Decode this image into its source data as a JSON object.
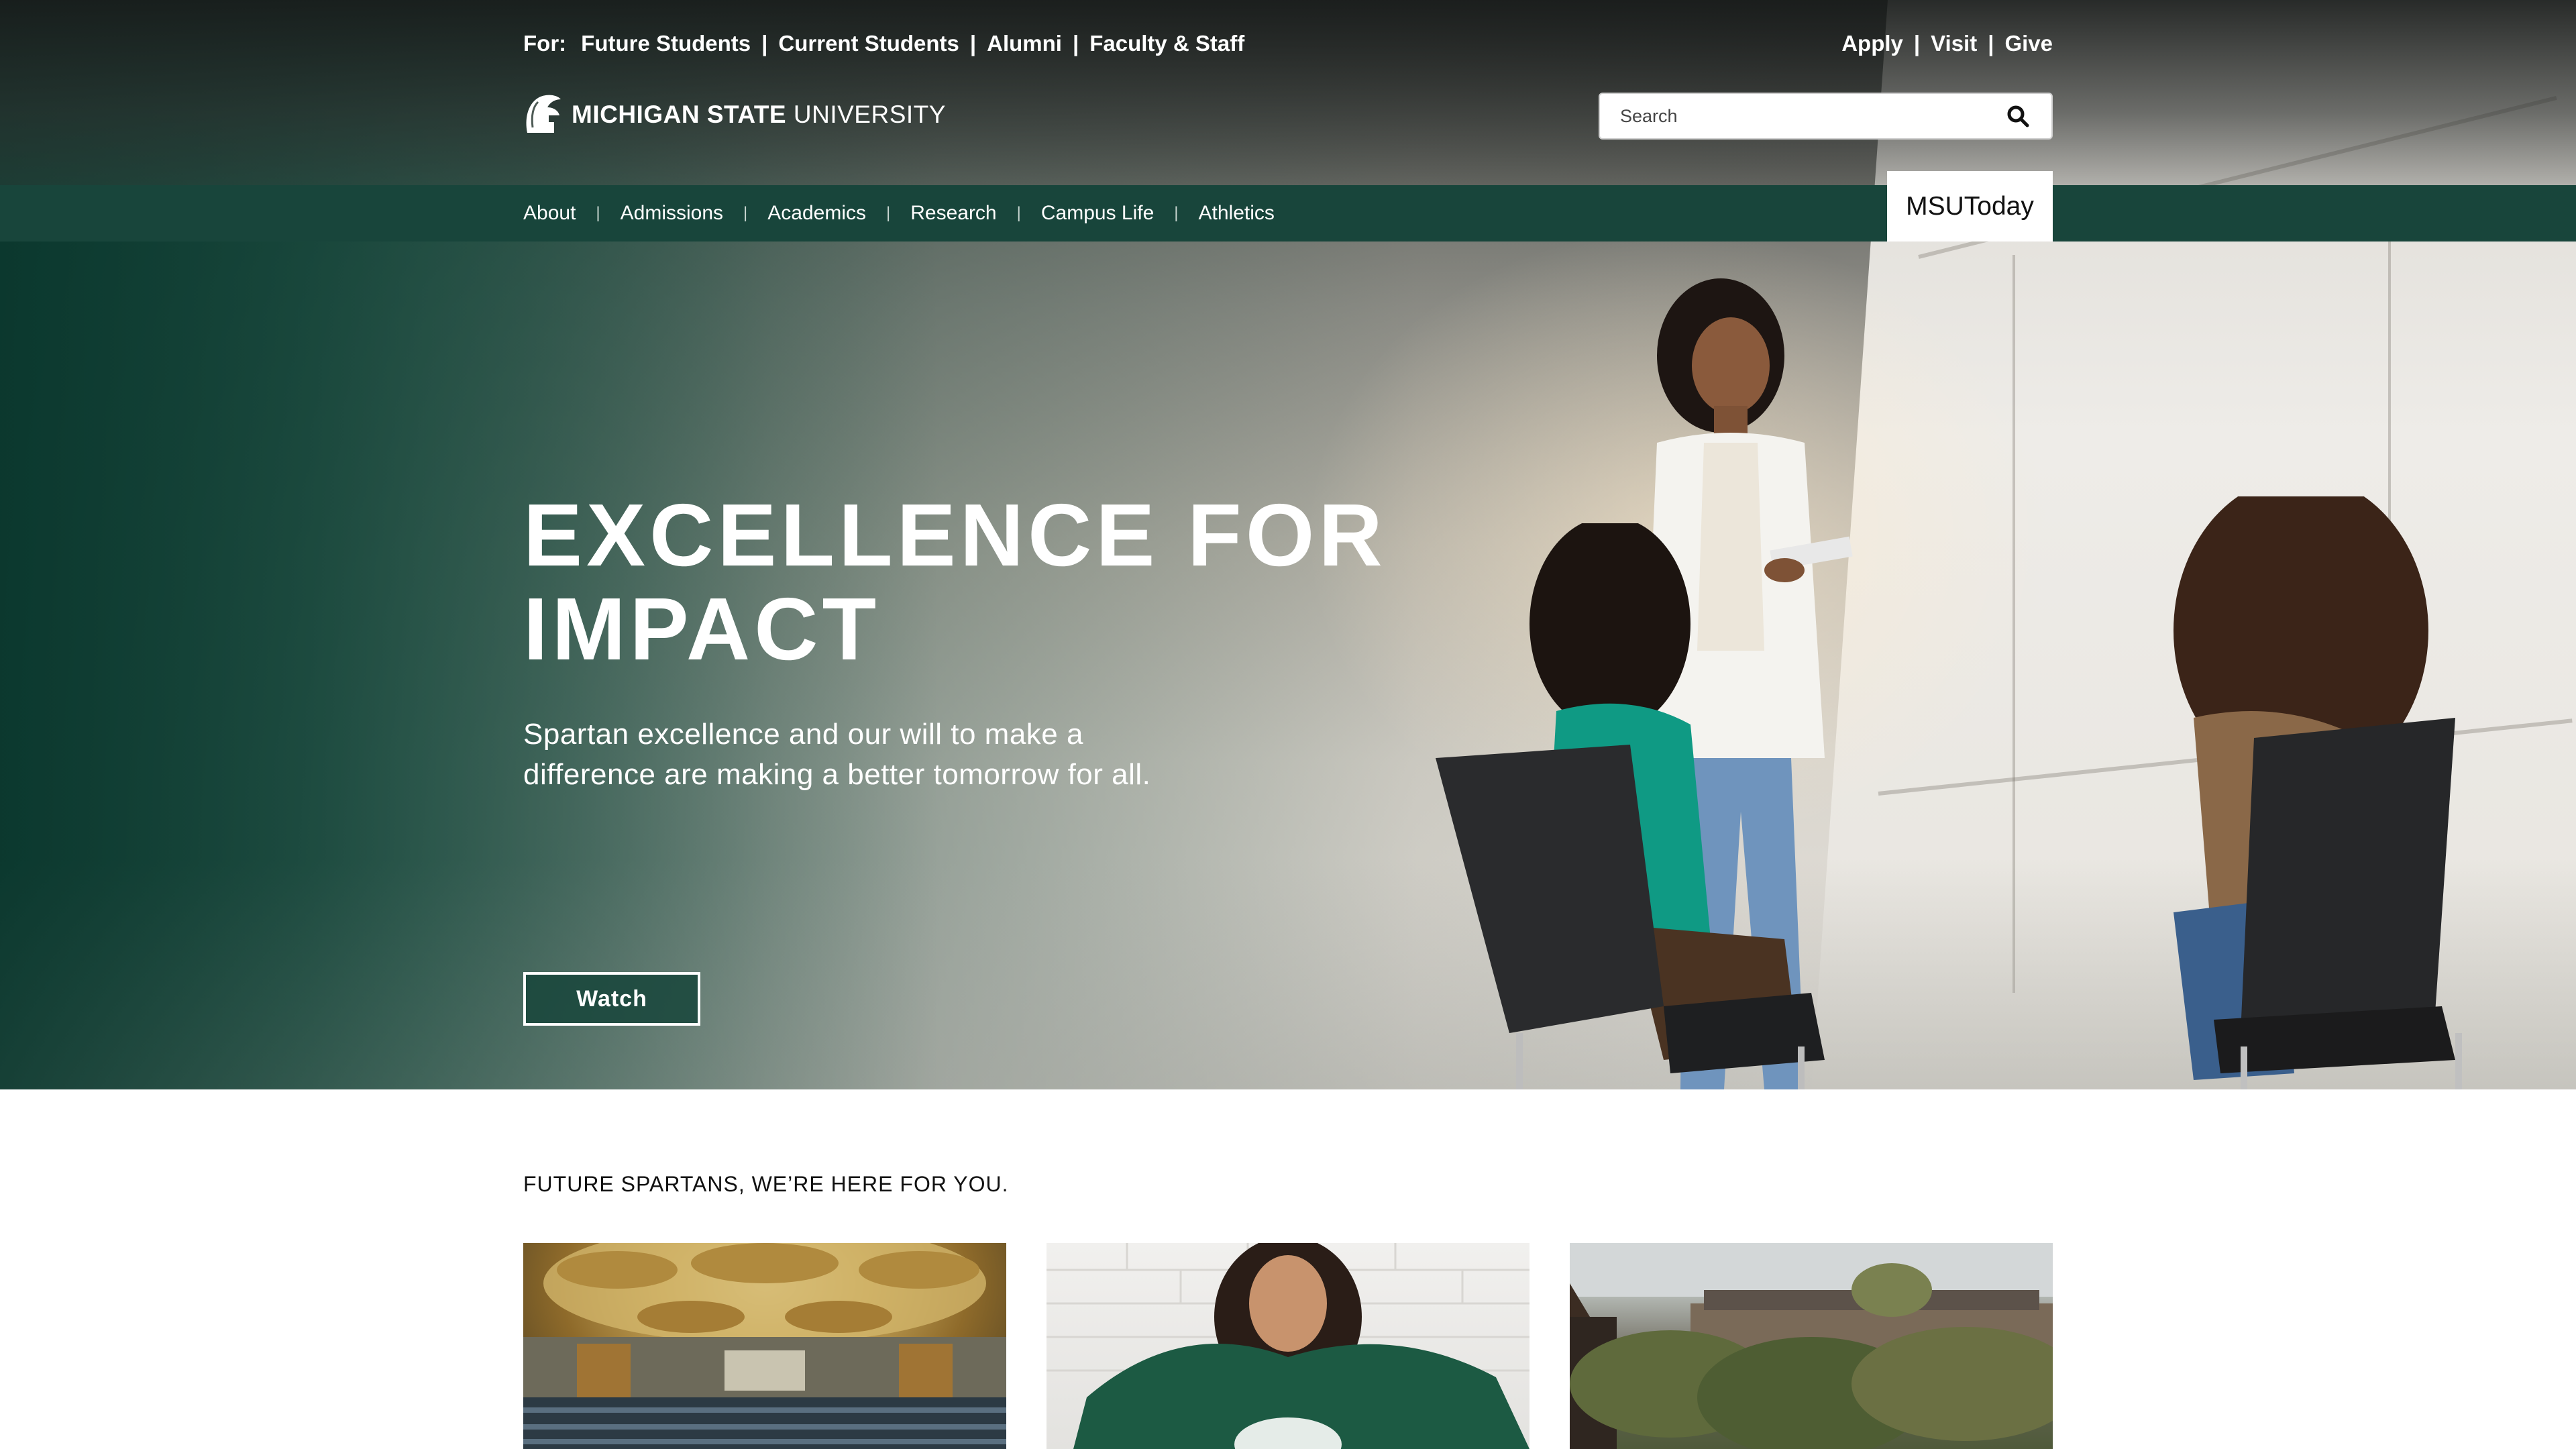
{
  "utility": {
    "for_label": "For:",
    "audience_links": [
      "Future Students",
      "Current Students",
      "Alumni",
      "Faculty & Staff"
    ],
    "action_links": [
      "Apply",
      "Visit",
      "Give"
    ],
    "separator": "|"
  },
  "logo": {
    "name_bold": "MICHIGAN STATE",
    "name_light": "UNIVERSITY"
  },
  "search": {
    "placeholder": "Search"
  },
  "nav": {
    "items": [
      "About",
      "Admissions",
      "Academics",
      "Research",
      "Campus Life",
      "Athletics"
    ],
    "separator": "|",
    "msutoday": "MSUToday"
  },
  "hero": {
    "title": "EXCELLENCE FOR IMPACT",
    "subtitle": "Spartan excellence and our will to make a difference are making a better tomorrow for all.",
    "button": "Watch"
  },
  "future": {
    "heading": "FUTURE SPARTANS, WE’RE HERE FOR YOU."
  },
  "colors": {
    "brand_green": "#18453b",
    "white": "#ffffff"
  }
}
